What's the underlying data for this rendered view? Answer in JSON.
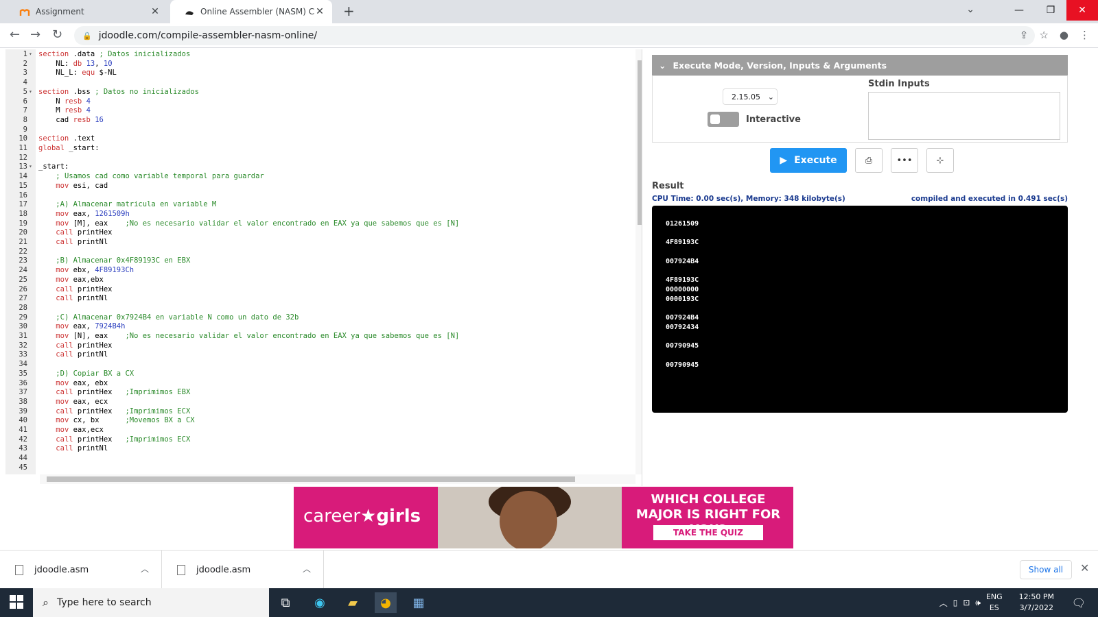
{
  "browser": {
    "tabs": [
      {
        "title": "Assignment",
        "favicon": "moodle-icon"
      },
      {
        "title": "Online Assembler (NASM) Comp",
        "favicon": "jdoodle-icon"
      }
    ],
    "url": "jdoodle.com/compile-assembler-nasm-online/"
  },
  "editor": {
    "lines": [
      {
        "n": "1",
        "fold": true,
        "html": "<span class='kw'>section</span> .data <span class='cm'>; Datos inicializados</span>"
      },
      {
        "n": "2",
        "html": "    NL: <span class='kw'>db</span> <span class='nm'>13</span>, <span class='nm'>10</span>"
      },
      {
        "n": "3",
        "html": "    NL_L: <span class='kw'>equ</span> $-NL"
      },
      {
        "n": "4",
        "html": ""
      },
      {
        "n": "5",
        "fold": true,
        "html": "<span class='kw'>section</span> .bss <span class='cm'>; Datos no inicializados</span>"
      },
      {
        "n": "6",
        "html": "    N <span class='kw'>resb</span> <span class='nm'>4</span>"
      },
      {
        "n": "7",
        "html": "    M <span class='kw'>resb</span> <span class='nm'>4</span>"
      },
      {
        "n": "8",
        "html": "    cad <span class='kw'>resb</span> <span class='nm'>16</span>"
      },
      {
        "n": "9",
        "html": ""
      },
      {
        "n": "10",
        "html": "<span class='kw'>section</span> .text"
      },
      {
        "n": "11",
        "html": "<span class='kw'>global</span> _start:"
      },
      {
        "n": "12",
        "html": ""
      },
      {
        "n": "13",
        "fold": true,
        "html": "_start:"
      },
      {
        "n": "14",
        "html": "    <span class='cm'>; Usamos cad como variable temporal para guardar</span>"
      },
      {
        "n": "15",
        "html": "    <span class='kw'>mov</span> esi, cad"
      },
      {
        "n": "16",
        "html": ""
      },
      {
        "n": "17",
        "html": "    <span class='cm'>;A) Almacenar matricula en variable M</span>"
      },
      {
        "n": "18",
        "html": "    <span class='kw'>mov</span> eax, <span class='nm'>1261509h</span>"
      },
      {
        "n": "19",
        "html": "    <span class='kw'>mov</span> [M], eax    <span class='cm'>;No es necesario validar el valor encontrado en EAX ya que sabemos que es [N]</span>"
      },
      {
        "n": "20",
        "html": "    <span class='kw'>call</span> printHex"
      },
      {
        "n": "21",
        "html": "    <span class='kw'>call</span> printNl"
      },
      {
        "n": "22",
        "html": ""
      },
      {
        "n": "23",
        "html": "    <span class='cm'>;B) Almacenar 0x4F89193C en EBX</span>"
      },
      {
        "n": "24",
        "html": "    <span class='kw'>mov</span> ebx, <span class='nm'>4F89193Ch</span>"
      },
      {
        "n": "25",
        "html": "    <span class='kw'>mov</span> eax,ebx"
      },
      {
        "n": "26",
        "html": "    <span class='kw'>call</span> printHex"
      },
      {
        "n": "27",
        "html": "    <span class='kw'>call</span> printNl"
      },
      {
        "n": "28",
        "html": ""
      },
      {
        "n": "29",
        "html": "    <span class='cm'>;C) Almacenar 0x7924B4 en variable N como un dato de 32b</span>"
      },
      {
        "n": "30",
        "html": "    <span class='kw'>mov</span> eax, <span class='nm'>7924B4h</span>"
      },
      {
        "n": "31",
        "html": "    <span class='kw'>mov</span> [N], eax    <span class='cm'>;No es necesario validar el valor encontrado en EAX ya que sabemos que es [N]</span>"
      },
      {
        "n": "32",
        "html": "    <span class='kw'>call</span> printHex"
      },
      {
        "n": "33",
        "html": "    <span class='kw'>call</span> printNl"
      },
      {
        "n": "34",
        "html": ""
      },
      {
        "n": "35",
        "html": "    <span class='cm'>;D) Copiar BX a CX</span>"
      },
      {
        "n": "36",
        "html": "    <span class='kw'>mov</span> eax, ebx"
      },
      {
        "n": "37",
        "html": "    <span class='kw'>call</span> printHex   <span class='cm'>;Imprimimos EBX</span>"
      },
      {
        "n": "38",
        "html": "    <span class='kw'>mov</span> eax, ecx"
      },
      {
        "n": "39",
        "html": "    <span class='kw'>call</span> printHex   <span class='cm'>;Imprimimos ECX</span>"
      },
      {
        "n": "40",
        "html": "    <span class='kw'>mov</span> cx, bx      <span class='cm'>;Movemos BX a CX</span>"
      },
      {
        "n": "41",
        "html": "    <span class='kw'>mov</span> eax,ecx"
      },
      {
        "n": "42",
        "html": "    <span class='kw'>call</span> printHex   <span class='cm'>;Imprimimos ECX</span>"
      },
      {
        "n": "43",
        "html": "    <span class='kw'>call</span> printNl"
      },
      {
        "n": "44",
        "html": ""
      },
      {
        "n": "45",
        "html": ""
      }
    ]
  },
  "exec_panel": {
    "header": "Execute Mode, Version, Inputs & Arguments",
    "version": "2.15.05",
    "interactive_label": "Interactive",
    "stdin_label": "Stdin Inputs",
    "execute_label": "Execute",
    "result_label": "Result",
    "cpu_info": "CPU Time: 0.00 sec(s), Memory: 348 kilobyte(s)",
    "compiled_info": "compiled and executed in 0.491 sec(s)",
    "output": [
      "01261509",
      "",
      "4F89193C",
      "",
      "007924B4",
      "",
      "4F89193C",
      "00000000",
      "0000193C",
      "",
      "007924B4",
      "00792434",
      "",
      "00790945",
      "",
      "00790945"
    ]
  },
  "ad": {
    "logo_a": "career",
    "logo_b": "girls",
    "headline": "WHICH COLLEGE MAJOR IS RIGHT FOR YOU?",
    "cta": "TAKE THE QUIZ"
  },
  "downloads": {
    "items": [
      "jdoodle.asm",
      "jdoodle.asm"
    ],
    "show_all": "Show all"
  },
  "taskbar": {
    "search_placeholder": "Type here to search",
    "lang_top": "ENG",
    "lang_bottom": "ES",
    "time": "12:50 PM",
    "date": "3/7/2022"
  }
}
